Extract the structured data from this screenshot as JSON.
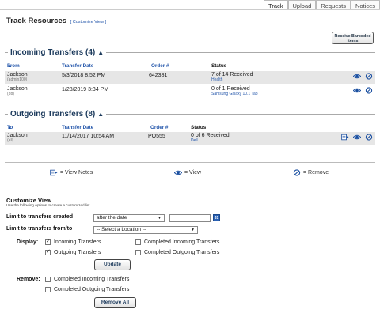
{
  "tabs": [
    {
      "label": "Track",
      "active": true
    },
    {
      "label": "Upload",
      "active": false
    },
    {
      "label": "Requests",
      "active": false
    },
    {
      "label": "Notices",
      "active": false
    }
  ],
  "page": {
    "title": "Track Resources",
    "customize_link": "[ Customize View ]",
    "receive_button": "Receive Barcoded Items"
  },
  "incoming": {
    "heading": "Incoming Transfers (4)",
    "columns": {
      "from": "From",
      "date": "Transfer Date",
      "order": "Order #",
      "status": "Status"
    },
    "rows": [
      {
        "name": "Jackson",
        "user": "(admin100)",
        "date": "5/3/2018 8:52 PM",
        "order": "642381",
        "status": "7 of 14 Received",
        "detail": "Health"
      },
      {
        "name": "Jackson",
        "user": "(bb)",
        "date": "1/28/2019 3:34 PM",
        "order": "",
        "status": "0 of 1 Received",
        "detail": "Samsung Galaxy 10.1 Tab"
      }
    ]
  },
  "outgoing": {
    "heading": "Outgoing Transfers (8)",
    "columns": {
      "to": "To",
      "date": "Transfer Date",
      "order": "Order #",
      "status": "Status"
    },
    "rows": [
      {
        "name": "Jackson",
        "user": "(all)",
        "date": "11/14/2017 10:54 AM",
        "order": "PO555",
        "status": "0 of 6 Received",
        "detail": "Dell"
      }
    ]
  },
  "legend": {
    "notes": "= View Notes",
    "view": "= View",
    "remove": "= Remove"
  },
  "customize": {
    "title": "Customize View",
    "description": "Use the following options to create a customized list.",
    "limit_created_label": "Limit to transfers created",
    "date_option": "after the date",
    "date_value": "",
    "limit_location_label": "Limit to transfers from/to",
    "location_option": "-- Select a Location --",
    "display_label": "Display:",
    "display_options": [
      {
        "label": "Incoming Transfers",
        "checked": true
      },
      {
        "label": "Outgoing Transfers",
        "checked": true
      },
      {
        "label": "Completed Incoming Transfers",
        "checked": false
      },
      {
        "label": "Completed Outgoing Transfers",
        "checked": false
      }
    ],
    "update_button": "Update",
    "remove_label": "Remove:",
    "remove_options": [
      {
        "label": "Completed Incoming Transfers",
        "checked": false
      },
      {
        "label": "Completed Outgoing Transfers",
        "checked": false
      }
    ],
    "remove_all_button": "Remove All"
  },
  "colors": {
    "accent": "#e46c0a",
    "link": "#2255aa",
    "heading": "#1c3a5c",
    "row_shade": "#e6e6e6"
  },
  "icons": [
    "view-notes-icon",
    "view-eye-icon",
    "remove-circle-icon",
    "calendar-icon",
    "sort-arrow-icon"
  ]
}
